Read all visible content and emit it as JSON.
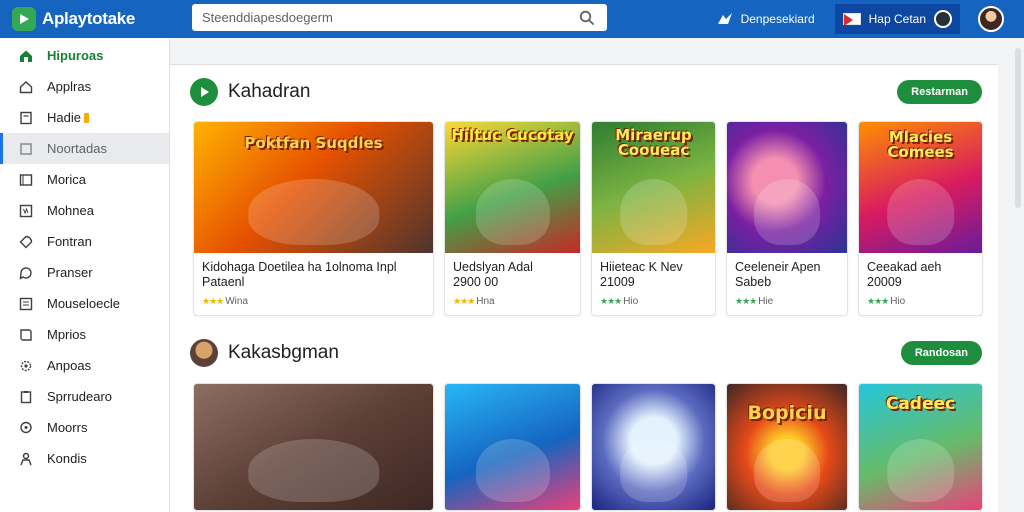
{
  "app": {
    "name": "Aplaytotake"
  },
  "search": {
    "placeholder": "Steenddiapesdoegerm"
  },
  "header": {
    "download_label": "Denpesekiard",
    "account_label": "Hap Cetan"
  },
  "sidebar": {
    "items": [
      {
        "label": "Hipuroas",
        "icon": "home-icon",
        "state": "active"
      },
      {
        "label": "Applras",
        "icon": "house-outline-icon",
        "state": ""
      },
      {
        "label": "Hadie",
        "icon": "note-icon",
        "state": "badge"
      },
      {
        "label": "Noortadas",
        "icon": "bookmark-icon",
        "state": "hover"
      },
      {
        "label": "Morica",
        "icon": "film-icon",
        "state": ""
      },
      {
        "label": "Mohnea",
        "icon": "grid-icon",
        "state": ""
      },
      {
        "label": "Fontran",
        "icon": "tag-icon",
        "state": ""
      },
      {
        "label": "Pranser",
        "icon": "chat-icon",
        "state": ""
      },
      {
        "label": "Mouseloecle",
        "icon": "list-icon",
        "state": ""
      },
      {
        "label": "Mprios",
        "icon": "book-icon",
        "state": ""
      },
      {
        "label": "Anpoas",
        "icon": "gear-icon",
        "state": ""
      },
      {
        "label": "Sprrudearo",
        "icon": "clipboard-icon",
        "state": ""
      },
      {
        "label": "Moorrs",
        "icon": "bubble-icon",
        "state": ""
      },
      {
        "label": "Kondis",
        "icon": "person-icon",
        "state": ""
      }
    ]
  },
  "sections": [
    {
      "title": "Kahadran",
      "more_label": "Restarman",
      "cards": [
        {
          "thumb_text": "Poktfan Suqdles",
          "title": "Kidohaga Doetilea ha 1olnoma Inpl",
          "subtitle": "Pataenl",
          "rating_label": "Wina",
          "star_color": "gold"
        },
        {
          "thumb_text": "Hiltuc Cucotay",
          "title": "Uedslyan Adal",
          "subtitle": "2900 00",
          "rating_label": "Hna",
          "star_color": "gold"
        },
        {
          "thumb_text": "Miraerup Cooueac",
          "title": "Hiieteac K Nev",
          "subtitle": "21009",
          "rating_label": "Hio",
          "star_color": "green"
        },
        {
          "thumb_text": "",
          "title": "Ceeleneir Apen",
          "subtitle": "Sabeb",
          "rating_label": "Hie",
          "star_color": "green"
        },
        {
          "thumb_text": "Mlacies Comees",
          "title": "Ceeakad aeh",
          "subtitle": "20009",
          "rating_label": "Hio",
          "star_color": "green"
        }
      ]
    },
    {
      "title": "Kakasbgman",
      "more_label": "Randosan",
      "cards": [
        {
          "thumb_text": ""
        },
        {
          "thumb_text": ""
        },
        {
          "thumb_text": ""
        },
        {
          "thumb_text": "Bopiciu"
        },
        {
          "thumb_text": "Cadeec"
        }
      ]
    }
  ],
  "colors": {
    "topbar": "#1565c0",
    "accent": "#1e8e3e",
    "active_nav": "#188038"
  }
}
